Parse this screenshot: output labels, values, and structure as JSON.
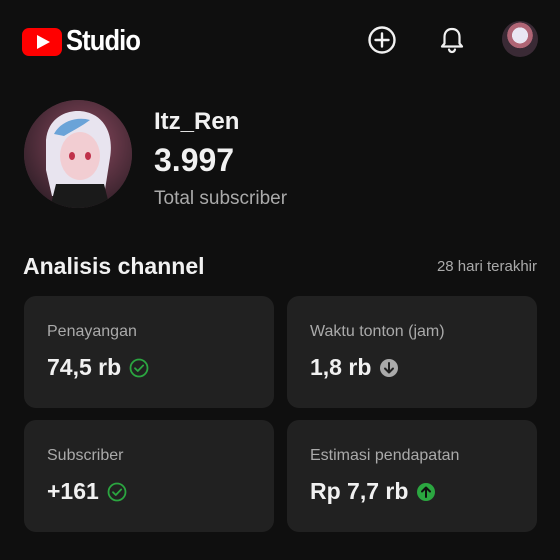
{
  "app": {
    "brand_label": "Studio"
  },
  "header": {
    "icons": [
      "create-icon",
      "notifications-icon",
      "account-avatar"
    ]
  },
  "channel": {
    "name": "Itz_Ren",
    "subscriber_count": "3.997",
    "subscriber_label": "Total subscriber"
  },
  "analytics": {
    "title": "Analisis channel",
    "period": "28 hari terakhir",
    "cards": [
      {
        "label": "Penayangan",
        "value": "74,5 rb",
        "status_icon": "check-circle-icon",
        "status_color": "#2ba640"
      },
      {
        "label": "Waktu tonton (jam)",
        "value": "1,8 rb",
        "status_icon": "arrow-down-circle-icon",
        "status_color": "#aaaaaa"
      },
      {
        "label": "Subscriber",
        "value": "+161",
        "status_icon": "check-circle-icon",
        "status_color": "#2ba640"
      },
      {
        "label": "Estimasi pendapatan",
        "value": "Rp 7,7 rb",
        "status_icon": "arrow-up-circle-icon",
        "status_color": "#2ba640"
      }
    ]
  },
  "colors": {
    "background": "#0f0f0f",
    "card": "#212121",
    "brand_red": "#ff0000",
    "text_secondary": "#aaaaaa",
    "positive": "#2ba640"
  }
}
